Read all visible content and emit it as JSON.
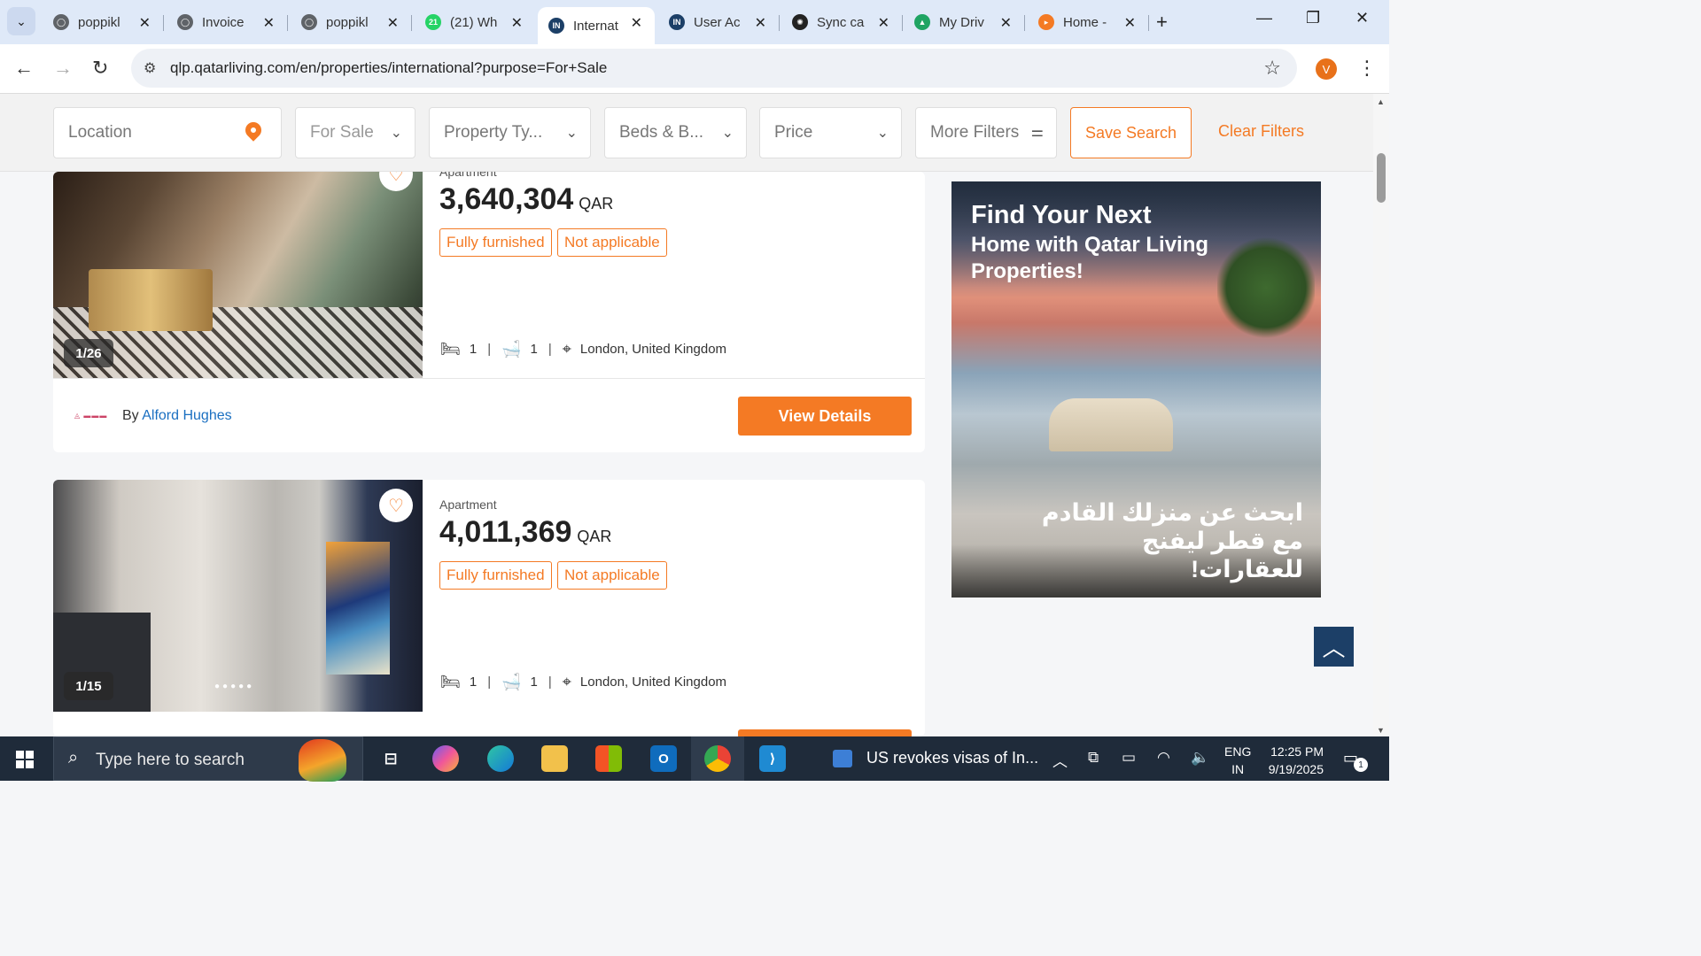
{
  "browser": {
    "tabs": [
      {
        "title": "poppikl",
        "favicon_color": "#5f6368",
        "favicon_text": ""
      },
      {
        "title": "Invoice",
        "favicon_color": "#5f6368",
        "favicon_text": ""
      },
      {
        "title": "poppikl",
        "favicon_color": "#5f6368",
        "favicon_text": ""
      },
      {
        "title": "(21) Wh",
        "favicon_color": "#25d366",
        "favicon_text": "21"
      },
      {
        "title": "Internat",
        "favicon_color": "#1c3f67",
        "favicon_text": "IN"
      },
      {
        "title": "User Ac",
        "favicon_color": "#1c3f67",
        "favicon_text": "IN"
      },
      {
        "title": "Sync ca",
        "favicon_color": "#222222",
        "favicon_text": "✺"
      },
      {
        "title": "My Driv",
        "favicon_color": "#1fa463",
        "favicon_text": "▲"
      },
      {
        "title": "Home -",
        "favicon_color": "#f47a24",
        "favicon_text": "▸"
      }
    ],
    "url": "qlp.qatarliving.com/en/properties/international?purpose=For+Sale",
    "profile_initial": "V"
  },
  "filters": {
    "location_placeholder": "Location",
    "purpose": "For Sale",
    "property_type": "Property Ty...",
    "beds_baths": "Beds & B...",
    "price": "Price",
    "more_filters": "More Filters",
    "save_search": "Save Search",
    "clear_filters": "Clear Filters"
  },
  "listings": [
    {
      "type": "Apartment",
      "price": "3,640,304",
      "currency": "QAR",
      "tags": [
        "Fully furnished",
        "Not applicable"
      ],
      "beds": "1",
      "baths": "1",
      "location": "London, United Kingdom",
      "photo_counter": "1/26",
      "by_label": "By",
      "agent": "Alford Hughes",
      "cta": "View Details"
    },
    {
      "type": "Apartment",
      "price": "4,011,369",
      "currency": "QAR",
      "tags": [
        "Fully furnished",
        "Not applicable"
      ],
      "beds": "1",
      "baths": "1",
      "location": "London, United Kingdom",
      "photo_counter": "1/15",
      "cta": ""
    }
  ],
  "ad": {
    "title_line1": "Find Your Next",
    "title_line2": "Home with Qatar Living Properties!",
    "arabic": "ابحث عن منزلك القادم مع قطر ليفنج للعقارات!"
  },
  "taskbar": {
    "search_placeholder": "Type here to search",
    "news": "US revokes visas of In...",
    "lang_line1": "ENG",
    "lang_line2": "IN",
    "time": "12:25 PM",
    "date": "9/19/2025",
    "notifications": "1"
  },
  "colors": {
    "accent": "#f47a24",
    "agent_link": "#1a6fc1",
    "scroll_top_button": "#1c3f67",
    "taskbar": "#1f2b3a"
  }
}
